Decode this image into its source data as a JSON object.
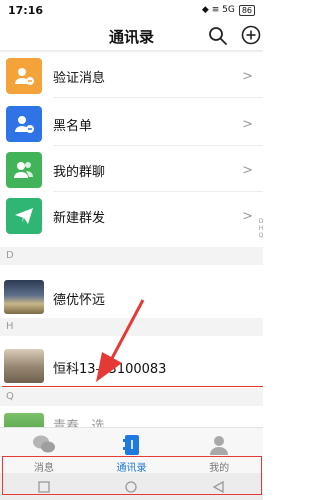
{
  "status": {
    "time": "17:16",
    "signal": "◆ ≡ 5G",
    "battery": "86"
  },
  "header": {
    "title": "通讯录"
  },
  "menu": [
    {
      "label": "验证消息",
      "color": "#f3a33a",
      "icon": "user-verify-icon"
    },
    {
      "label": "黑名单",
      "color": "#2f74e6",
      "icon": "user-block-icon"
    },
    {
      "label": "我的群聊",
      "color": "#41b45a",
      "icon": "group-icon"
    },
    {
      "label": "新建群发",
      "color": "#2fb574",
      "icon": "paper-plane-icon"
    }
  ],
  "chevron": ">",
  "sections": {
    "d": "D",
    "h": "H",
    "q": "Q"
  },
  "contacts": {
    "d": "德优怀远",
    "h": "恒科13—3100083",
    "q_partial": "青春...选"
  },
  "index_letters": "D\nH\nQ",
  "tabs": [
    {
      "label": "消息",
      "icon": "chat-bubble-icon"
    },
    {
      "label": "通讯录",
      "icon": "contacts-icon"
    },
    {
      "label": "我的",
      "icon": "profile-icon"
    }
  ],
  "accent": "#1f7ae0"
}
